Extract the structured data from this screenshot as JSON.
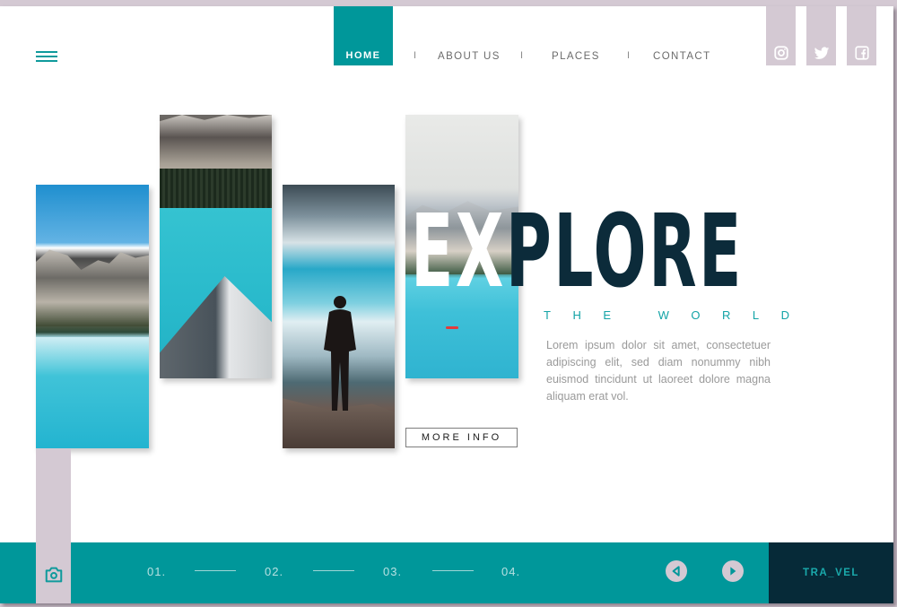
{
  "header": {
    "menu_icon": "hamburger-menu-icon",
    "nav": [
      {
        "label": "HOME",
        "active": true
      },
      {
        "label": "ABOUT US",
        "active": false
      },
      {
        "label": "PLACES",
        "active": false
      },
      {
        "label": "CONTACT",
        "active": false
      }
    ],
    "separator": "I",
    "social": [
      {
        "name": "instagram",
        "icon": "instagram-icon"
      },
      {
        "name": "twitter",
        "icon": "twitter-icon"
      },
      {
        "name": "facebook",
        "icon": "facebook-icon"
      }
    ]
  },
  "hero": {
    "title_part1": "EX",
    "title_part2": "PLORE",
    "subtitle": "THE WORLD",
    "description": "Lorem ipsum dolor sit amet, consectetuer adipiscing elit, sed diam nonummy nibh euismod tincidunt ut laoreet dolore magna aliquam erat vol.",
    "cta_label": "MORE INFO",
    "photos": [
      {
        "subject": "mountain lake reflection"
      },
      {
        "subject": "canoe bow on turquoise lake"
      },
      {
        "subject": "person standing on cliff"
      },
      {
        "subject": "misty lake with kayak"
      }
    ]
  },
  "footer": {
    "camera_icon": "camera-icon",
    "steps": [
      "01.",
      "02.",
      "03.",
      "04."
    ],
    "prev_icon": "arrow-left-icon",
    "next_icon": "arrow-right-icon",
    "brand": "TRA_VEL"
  },
  "colors": {
    "teal": "#00979A",
    "navy": "#0C2B3A",
    "lilac": "#D4C9D3",
    "brand_bg": "#062A38"
  }
}
